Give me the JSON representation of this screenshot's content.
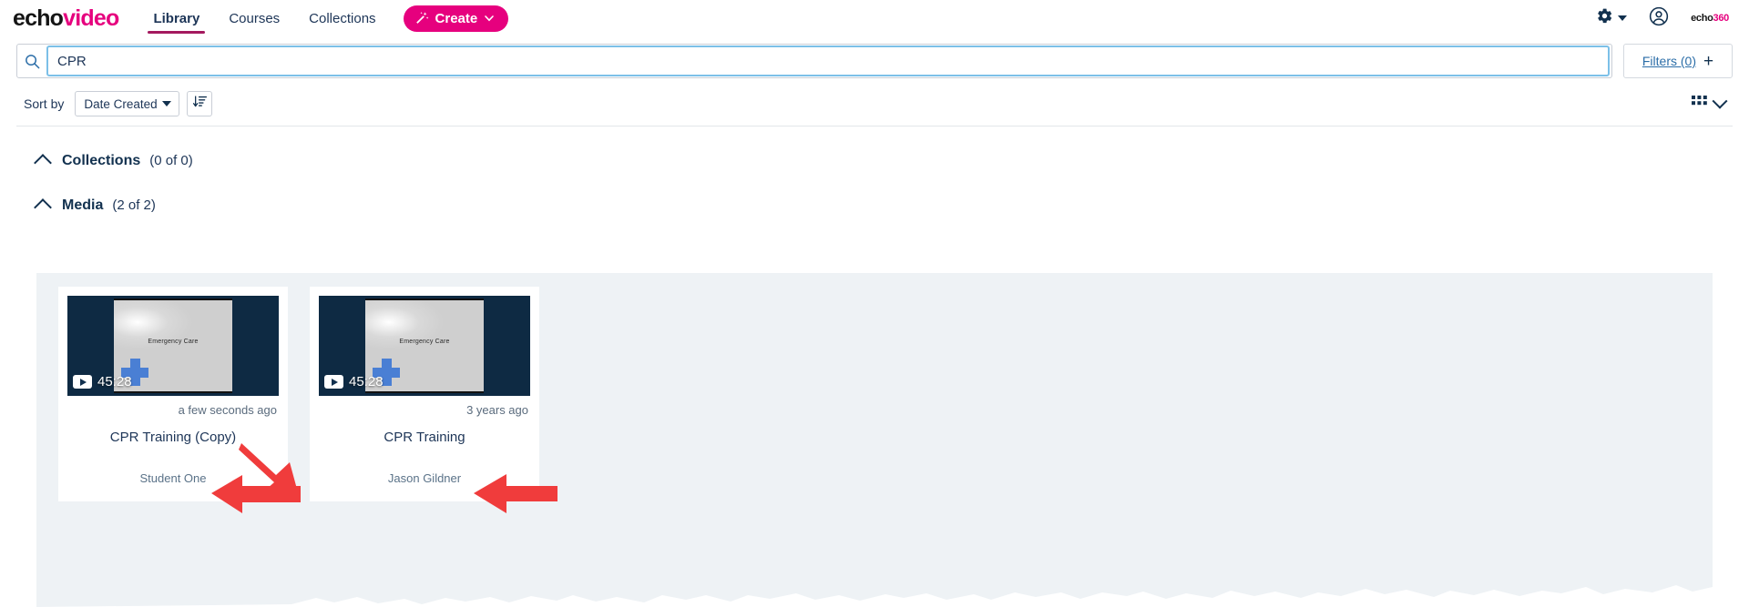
{
  "brand": {
    "name_part1": "echo",
    "name_part2": "video",
    "mini_part1": "echo",
    "mini_part2": "360"
  },
  "nav": {
    "items": [
      {
        "label": "Library",
        "active": true
      },
      {
        "label": "Courses",
        "active": false
      },
      {
        "label": "Collections",
        "active": false
      }
    ],
    "create_label": "Create",
    "create_icon": "magic-wand-icon",
    "create_color": "#e6007e"
  },
  "topbar_right": {
    "settings_icon": "gear-icon",
    "settings_caret": "caret-down-icon",
    "account_icon": "user-avatar-icon"
  },
  "search": {
    "icon": "search-icon",
    "value": "CPR",
    "placeholder": "",
    "filters_label": "Filters (0)",
    "filters_icon": "plus-icon"
  },
  "sort": {
    "label": "Sort by",
    "selected": "Date Created",
    "options": [
      "Date Created"
    ],
    "caret_icon": "chevron-down-icon",
    "direction_icon": "sort-descending-icon"
  },
  "view": {
    "grid_icon": "grid-view-icon",
    "caret_icon": "chevron-down-icon"
  },
  "groups": [
    {
      "name": "collections",
      "title": "Collections",
      "count": "(0 of 0)",
      "toggle_icon": "chevron-up-icon"
    },
    {
      "name": "media",
      "title": "Media",
      "count": "(2 of 2)",
      "toggle_icon": "chevron-up-icon"
    }
  ],
  "media_cards": [
    {
      "title": "CPR Training (Copy)",
      "time": "a few seconds ago",
      "owner": "Student One",
      "duration": "45:28",
      "thumb_text": "Emergency Care",
      "play_icon": "play-icon"
    },
    {
      "title": "CPR Training",
      "time": "3 years ago",
      "owner": "Jason Gildner",
      "duration": "45:28",
      "thumb_text": "Emergency Care",
      "play_icon": "play-icon"
    }
  ],
  "annotations": {
    "color": "#f03c3c",
    "arrows": [
      {
        "name": "arrow-to-copy-title",
        "target": "CPR Training (Copy)"
      },
      {
        "name": "arrow-to-student-one",
        "target": "Student One"
      },
      {
        "name": "arrow-to-jason-gildner",
        "target": "Jason Gildner"
      }
    ]
  }
}
